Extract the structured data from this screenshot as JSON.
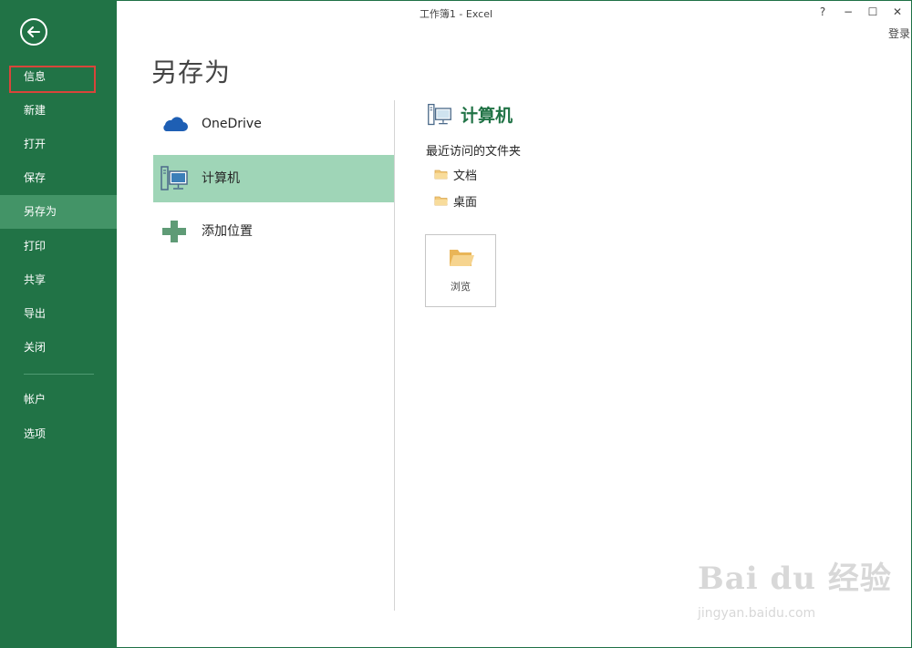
{
  "window": {
    "title": "工作簿1 - Excel",
    "help": "?",
    "minimize": "−",
    "maximize": "☐",
    "close": "✕",
    "signin": "登录"
  },
  "sidebar": {
    "items": [
      {
        "label": "信息",
        "active": false
      },
      {
        "label": "新建",
        "active": false
      },
      {
        "label": "打开",
        "active": false
      },
      {
        "label": "保存",
        "active": false
      },
      {
        "label": "另存为",
        "active": true
      },
      {
        "label": "打印",
        "active": false
      },
      {
        "label": "共享",
        "active": false
      },
      {
        "label": "导出",
        "active": false
      },
      {
        "label": "关闭",
        "active": false
      },
      {
        "label": "帐户",
        "active": false
      },
      {
        "label": "选项",
        "active": false
      }
    ]
  },
  "main": {
    "title": "另存为",
    "places": [
      {
        "label": "OneDrive",
        "icon": "cloud-icon"
      },
      {
        "label": "计算机",
        "icon": "computer-icon",
        "active": true
      },
      {
        "label": "添加位置",
        "icon": "plus-icon"
      }
    ],
    "computer": {
      "heading": "计算机",
      "recent_label": "最近访问的文件夹",
      "folders": [
        {
          "label": "文档"
        },
        {
          "label": "桌面"
        }
      ],
      "browse_label": "浏览"
    }
  },
  "watermark": {
    "brand": "Bai du 经验",
    "url": "jingyan.baidu.com"
  },
  "colors": {
    "sidebar": "#217346",
    "sidebar_active": "#439467",
    "place_active": "#9fd5b7",
    "highlight_box": "#d9453a"
  }
}
